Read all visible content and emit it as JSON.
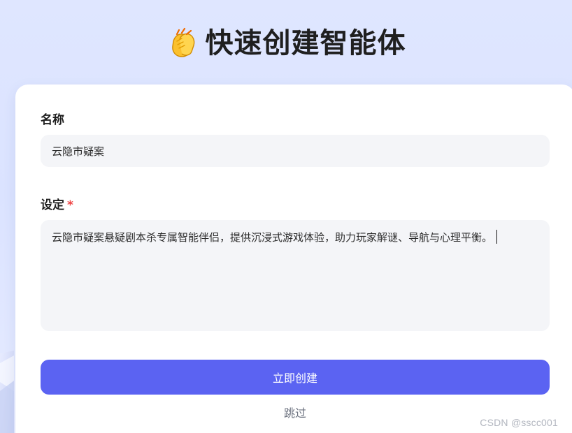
{
  "header": {
    "emoji": "clapping-hands-icon",
    "title": "快速创建智能体"
  },
  "form": {
    "name_label": "名称",
    "name_value": "云隐市疑案",
    "setting_label": "设定",
    "setting_required_mark": "*",
    "setting_value": "云隐市疑案悬疑剧本杀专属智能伴侣，提供沉浸式游戏体验，助力玩家解谜、导航与心理平衡。"
  },
  "actions": {
    "create_label": "立即创建",
    "skip_label": "跳过"
  },
  "watermark": {
    "text": "CSDN @sscc001"
  },
  "colors": {
    "primary": "#5B63F2",
    "required": "#EF4444",
    "field_background": "#F4F5F8"
  }
}
